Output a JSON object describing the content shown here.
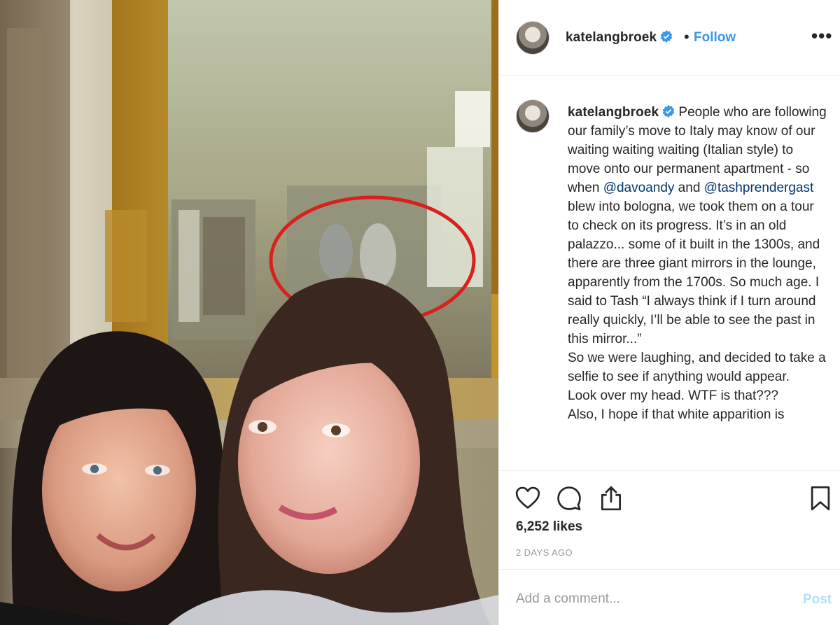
{
  "post": {
    "username": "katelangbroek",
    "follow_label": "Follow",
    "more_label": "•••",
    "separator": "•",
    "caption_paragraphs": [
      {
        "parts": [
          {
            "text": "People who are following our family’s move to Italy may know of our waiting waiting waiting (Italian style) to move onto our permanent apartment - so when ",
            "kind": "text"
          },
          {
            "text": "@davoandy",
            "kind": "mention"
          },
          {
            "text": " and ",
            "kind": "text"
          },
          {
            "text": "@tashprendergast",
            "kind": "mention"
          },
          {
            "text": " blew into bologna, we took them on a tour to check on its progress. It’s in an old palazzo... some of it built in the 1300s, and there are three giant mirrors in the lounge, apparently from the 1700s. So much age. I said to Tash “I always think if I turn around really quickly, I’ll be able to see the past in this mirror...”",
            "kind": "text"
          }
        ]
      },
      {
        "parts": [
          {
            "text": "So we were laughing, and decided to take a selfie to see if anything would appear.",
            "kind": "text"
          }
        ]
      },
      {
        "parts": [
          {
            "text": "Look over my head. WTF is that???",
            "kind": "text"
          }
        ]
      },
      {
        "parts": [
          {
            "text": "Also, I hope if that white apparition is",
            "kind": "text"
          }
        ]
      }
    ],
    "likes": "6,252 likes",
    "time_ago": "2 DAYS AGO",
    "comment_placeholder": "Add a comment...",
    "post_label": "Post"
  },
  "icons": {
    "verified": "verified-badge-icon",
    "like": "heart-icon",
    "comment": "comment-icon",
    "share": "share-icon",
    "save": "bookmark-icon"
  },
  "colors": {
    "link_blue": "#3897f0",
    "mention": "#003569",
    "post_disabled": "#b2dffc",
    "highlight_circle": "#d9201c"
  }
}
